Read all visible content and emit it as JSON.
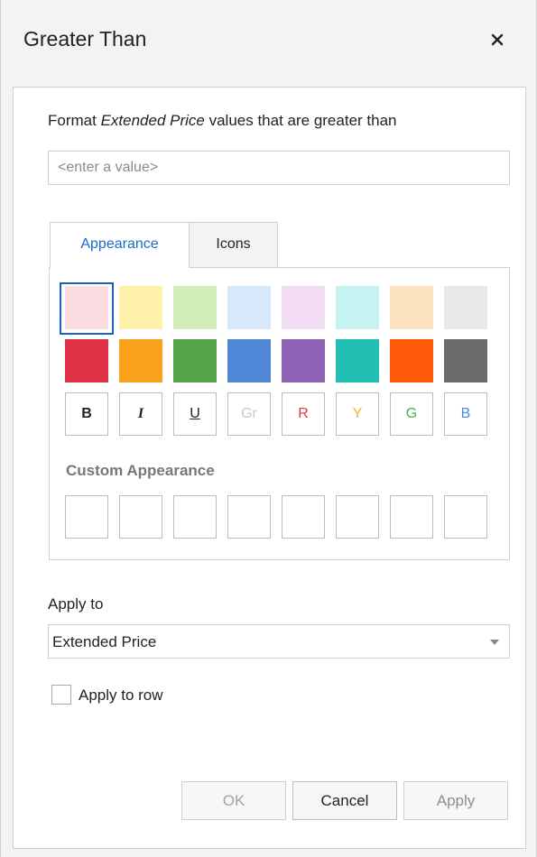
{
  "dialog": {
    "title": "Greater Than",
    "close_icon": "close-icon",
    "description_prefix": "Format ",
    "description_field": "Extended Price",
    "description_suffix": " values that are greater than",
    "value_input": {
      "value": "",
      "placeholder": "<enter a value>"
    }
  },
  "tabs": [
    {
      "label": "Appearance",
      "active": true
    },
    {
      "label": "Icons",
      "active": false
    }
  ],
  "appearance": {
    "light_swatches": [
      "#fcdde2",
      "#fdf1a9",
      "#d3edb9",
      "#d7e8fb",
      "#f1dcf4",
      "#c4f3f2",
      "#fde2be",
      "#e8e8e8"
    ],
    "dark_swatches": [
      "#df3446",
      "#fba21d",
      "#57a54b",
      "#4f87d6",
      "#9063b6",
      "#22bfb4",
      "#fe5a0a",
      "#6b6b6b"
    ],
    "selected_swatch_index": 0,
    "font_formats": [
      {
        "label": "B",
        "color": "#222222"
      },
      {
        "label": "I",
        "color": "#222222"
      },
      {
        "label": "U",
        "color": "#222222"
      },
      {
        "label": "Gr",
        "color": "#c8c8c8"
      },
      {
        "label": "R",
        "color": "#e0364e"
      },
      {
        "label": "Y",
        "color": "#f5b52a"
      },
      {
        "label": "G",
        "color": "#4fae4b"
      },
      {
        "label": "B",
        "color": "#4f87d6"
      }
    ],
    "custom_label": "Custom Appearance",
    "custom_slots": 8
  },
  "apply_to": {
    "label": "Apply to",
    "selected": "Extended Price",
    "dropdown_icon": "chevron-down-icon"
  },
  "apply_to_row": {
    "label": "Apply to row",
    "checked": false
  },
  "buttons": {
    "ok": "OK",
    "cancel": "Cancel",
    "apply": "Apply"
  }
}
